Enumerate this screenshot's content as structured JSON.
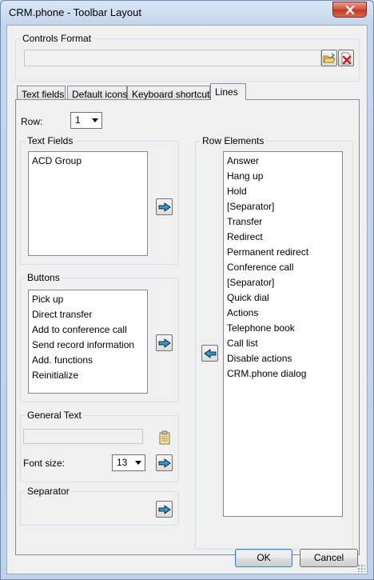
{
  "window": {
    "title": "CRM.phone - Toolbar Layout"
  },
  "controls_format": {
    "label": "Controls Format",
    "value": ""
  },
  "tabs": [
    {
      "label": "Text fields"
    },
    {
      "label": "Default icons"
    },
    {
      "label": "Keyboard shortcuts"
    },
    {
      "label": "Lines"
    }
  ],
  "row": {
    "label": "Row:",
    "value": "1"
  },
  "text_fields": {
    "label": "Text Fields",
    "items": [
      "ACD Group"
    ]
  },
  "buttons": {
    "label": "Buttons",
    "items": [
      "Pick up",
      "Direct transfer",
      "Add to conference call",
      "Send record information",
      "Add. functions",
      "Reinitialize"
    ]
  },
  "general_text": {
    "label": "General Text",
    "value": "",
    "font_size_label": "Font size:",
    "font_size_value": "13"
  },
  "separator": {
    "label": "Separator"
  },
  "row_elements": {
    "label": "Row Elements",
    "items": [
      "Answer",
      "Hang up",
      "Hold",
      "[Separator]",
      "Transfer",
      "Redirect",
      "Permanent redirect",
      "Conference call",
      "[Separator]",
      "Quick dial",
      "Actions",
      "Telephone book",
      "Call list",
      "Disable actions",
      "CRM.phone dialog"
    ]
  },
  "footer": {
    "ok_label": "OK",
    "cancel_label": "Cancel"
  }
}
